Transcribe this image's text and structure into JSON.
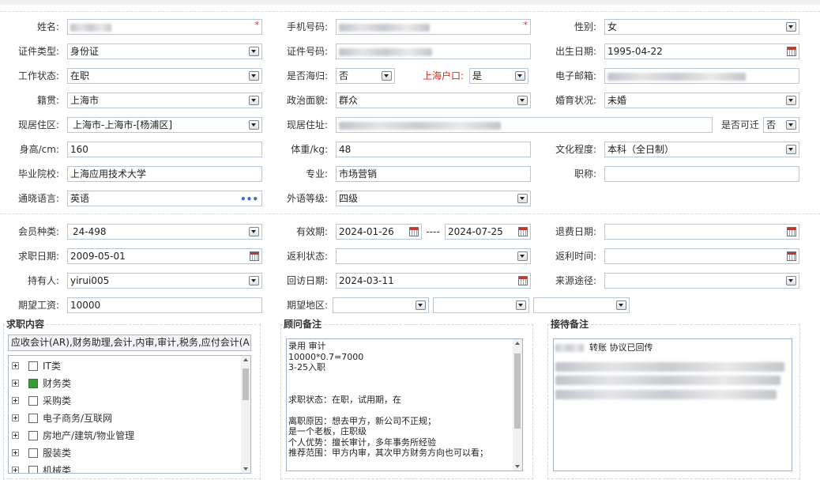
{
  "form": {
    "name_label": "姓名:",
    "phone_label": "手机号码:",
    "gender_label": "性别:",
    "gender_value": "女",
    "idtype_label": "证件类型:",
    "idtype_value": "身份证",
    "idno_label": "证件号码:",
    "birth_label": "出生日期:",
    "birth_value": "1995-04-22",
    "workstatus_label": "工作状态:",
    "workstatus_value": "在职",
    "returnee_label": "是否海归:",
    "returnee_value": "否",
    "shhukou_label": "上海户口:",
    "shhukou_value": "是",
    "email_label": "电子邮箱:",
    "native_label": "籍贯:",
    "native_value": "上海市",
    "political_label": "政治面貌:",
    "political_value": "群众",
    "marital_label": "婚育状况:",
    "marital_value": "未婚",
    "residence_area_label": "现居住区:",
    "residence_area_value": "上海市-上海市-[杨浦区]",
    "address_label": "现居住址:",
    "relocate_label": "是否可迁",
    "relocate_value": "否",
    "height_label": "身高/cm:",
    "height_value": "160",
    "weight_label": "体重/kg:",
    "weight_value": "48",
    "education_label": "文化程度:",
    "education_value": "本科（全日制）",
    "school_label": "毕业院校:",
    "school_value": "上海应用技术大学",
    "major_label": "专业:",
    "major_value": "市场营销",
    "title_label": "职称:",
    "title_value": "",
    "language_label": "通晓语言:",
    "language_value": "英语",
    "lang_level_label": "外语等级:",
    "lang_level_value": "四级",
    "member_type_label": "会员种类:",
    "member_type_value": "24-498",
    "valid_label": "有效期:",
    "valid_from": "2024-01-26",
    "valid_dash": "----",
    "valid_to": "2024-07-25",
    "refund_date_label": "退费日期:",
    "refund_date_value": "",
    "job_date_label": "求职日期:",
    "job_date_value": "2009-05-01",
    "rebate_status_label": "返利状态:",
    "rebate_status_value": "",
    "rebate_time_label": "返利时间:",
    "rebate_time_value": "",
    "holder_label": "持有人:",
    "holder_value": "yirui005",
    "visit_date_label": "回访日期:",
    "visit_date_value": "2024-03-11",
    "source_label": "来源途径:",
    "source_value": "",
    "salary_label": "期望工资:",
    "salary_value": "10000",
    "area_label": "期望地区:"
  },
  "job_content": {
    "title": "求职内容",
    "summary": "应收会计(AR),财务助理,会计,内审,审计,税务,应付会计(AP)",
    "tree": [
      {
        "label": "IT类",
        "checked": false
      },
      {
        "label": "财务类",
        "checked": true
      },
      {
        "label": "采购类",
        "checked": false
      },
      {
        "label": "电子商务/互联网",
        "checked": false
      },
      {
        "label": "房地产/建筑/物业管理",
        "checked": false
      },
      {
        "label": "服装类",
        "checked": false
      },
      {
        "label": "机械类",
        "checked": false
      }
    ]
  },
  "advisor_notes": {
    "title": "顾问备注",
    "lines": [
      "录用    审计",
      "10000*0.7=7000",
      "3-25入职",
      "",
      "",
      "求职状态：在职，试用期，在",
      "",
      "离职原因：想去甲方，新公司不正规；",
      "是一个老板，庄职级",
      "个人优势：擅长审计，多年事务所经验",
      "推荐范围：甲方内审，其次甲方财务方向也可以看；"
    ]
  },
  "reception_notes": {
    "title": "接待备注",
    "line1": "转账 协议已回传"
  },
  "colors": {
    "border": "#b7c7d8",
    "required": "#e0251b",
    "checked": "#3a9a3a"
  }
}
